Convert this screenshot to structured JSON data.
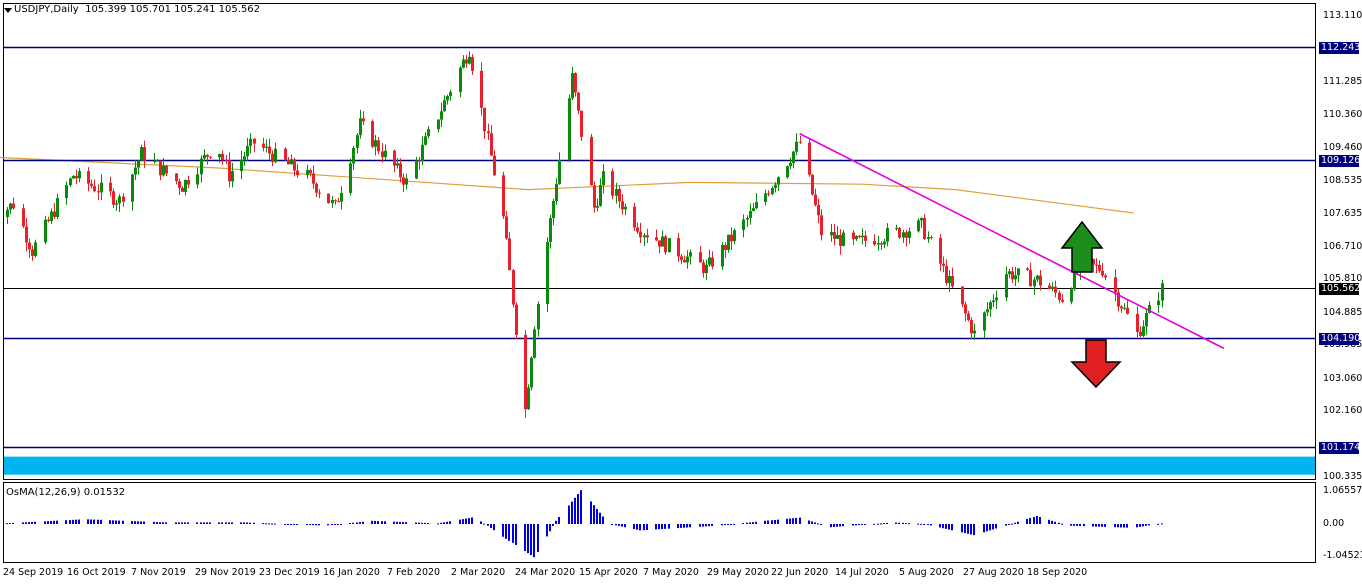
{
  "header": {
    "symbol_label": "USDJPY,Daily",
    "ohlc_text": "105.399 105.701 105.241 105.562"
  },
  "oscillator": {
    "label": "OsMA(12,26,9) 0.01532",
    "ticks": [
      "1.06557",
      "0.00",
      "-1.04521"
    ]
  },
  "colors": {
    "background": "#ffffff",
    "bull": "#0a8a0a",
    "bear": "#e8202a",
    "level_line": "#00007f",
    "trendline": "#e000e0",
    "moving_average": "#e0a040",
    "price_line": "#000000",
    "zone": "#00b4f0",
    "histogram": "#0000e0",
    "arrow_up": "#1c8c1c",
    "arrow_down": "#e02020"
  },
  "chart_data": {
    "type": "candlestick",
    "symbol": "USDJPY",
    "timeframe": "Daily",
    "last": {
      "open": 105.399,
      "high": 105.701,
      "low": 105.241,
      "close": 105.562
    },
    "y_ticks": [
      "113.110",
      "111.285",
      "110.360",
      "109.460",
      "108.535",
      "107.635",
      "106.710",
      "105.810",
      "104.885",
      "103.985",
      "103.060",
      "102.160",
      "100.335"
    ],
    "x_ticks": [
      "24 Sep 2019",
      "16 Oct 2019",
      "7 Nov 2019",
      "29 Nov 2019",
      "23 Dec 2019",
      "16 Jan 2020",
      "7 Feb 2020",
      "2 Mar 2020",
      "24 Mar 2020",
      "15 Apr 2020",
      "7 May 2020",
      "29 May 2020",
      "22 Jun 2020",
      "14 Jul 2020",
      "5 Aug 2020",
      "27 Aug 2020",
      "18 Sep 2020"
    ],
    "levels": [
      {
        "label": "112.243",
        "value": 112.243
      },
      {
        "label": "109.126",
        "value": 109.126
      },
      {
        "label": "105.562",
        "value": 105.562,
        "kind": "current"
      },
      {
        "label": "104.190",
        "value": 104.19
      },
      {
        "label": "101.174",
        "value": 101.174
      }
    ],
    "zone": {
      "from": 100.4,
      "to": 100.9
    },
    "trendline": {
      "from": {
        "date": "2020-06-05",
        "price": 109.85
      },
      "to": {
        "date": "2020-10-19",
        "price": 103.9
      }
    },
    "moving_average": [
      {
        "date": "2019-09-20",
        "price": 109.2
      },
      {
        "date": "2019-12-01",
        "price": 108.9
      },
      {
        "date": "2020-01-20",
        "price": 108.6
      },
      {
        "date": "2020-03-10",
        "price": 108.3
      },
      {
        "date": "2020-05-01",
        "price": 108.5
      },
      {
        "date": "2020-06-25",
        "price": 108.45
      },
      {
        "date": "2020-07-25",
        "price": 108.3
      },
      {
        "date": "2020-09-20",
        "price": 107.65
      }
    ],
    "price_path": [
      {
        "date": "2019-09-20",
        "price": 107.5
      },
      {
        "date": "2019-09-27",
        "price": 107.9
      },
      {
        "date": "2019-10-03",
        "price": 106.6
      },
      {
        "date": "2019-10-16",
        "price": 108.7
      },
      {
        "date": "2019-10-31",
        "price": 108.0
      },
      {
        "date": "2019-11-07",
        "price": 109.3
      },
      {
        "date": "2019-11-20",
        "price": 108.4
      },
      {
        "date": "2019-12-01",
        "price": 109.6
      },
      {
        "date": "2019-12-05",
        "price": 108.7
      },
      {
        "date": "2019-12-13",
        "price": 109.6
      },
      {
        "date": "2019-12-31",
        "price": 108.6
      },
      {
        "date": "2020-01-08",
        "price": 107.8
      },
      {
        "date": "2020-01-16",
        "price": 110.1
      },
      {
        "date": "2020-01-31",
        "price": 108.5
      },
      {
        "date": "2020-02-07",
        "price": 109.8
      },
      {
        "date": "2020-02-20",
        "price": 112.2
      },
      {
        "date": "2020-03-02",
        "price": 107.5
      },
      {
        "date": "2020-03-09",
        "price": 102.2
      },
      {
        "date": "2020-03-12",
        "price": 104.6
      },
      {
        "date": "2020-03-18",
        "price": 108.0
      },
      {
        "date": "2020-03-24",
        "price": 111.4
      },
      {
        "date": "2020-03-31",
        "price": 107.8
      },
      {
        "date": "2020-04-03",
        "price": 108.6
      },
      {
        "date": "2020-04-15",
        "price": 107.2
      },
      {
        "date": "2020-05-06",
        "price": 106.1
      },
      {
        "date": "2020-05-21",
        "price": 107.7
      },
      {
        "date": "2020-06-05",
        "price": 109.6
      },
      {
        "date": "2020-06-12",
        "price": 107.1
      },
      {
        "date": "2020-06-22",
        "price": 106.8
      },
      {
        "date": "2020-07-14",
        "price": 107.3
      },
      {
        "date": "2020-07-31",
        "price": 104.3
      },
      {
        "date": "2020-08-10",
        "price": 106.0
      },
      {
        "date": "2020-08-20",
        "price": 105.8
      },
      {
        "date": "2020-08-28",
        "price": 105.3
      },
      {
        "date": "2020-09-03",
        "price": 106.2
      },
      {
        "date": "2020-09-10",
        "price": 106.1
      },
      {
        "date": "2020-09-21",
        "price": 104.3
      },
      {
        "date": "2020-09-29",
        "price": 105.56
      }
    ],
    "osma_shape": [
      {
        "date": "2019-09-20",
        "value": 0.0
      },
      {
        "date": "2019-10-20",
        "value": 0.15
      },
      {
        "date": "2019-11-15",
        "value": 0.05
      },
      {
        "date": "2019-12-10",
        "value": 0.05
      },
      {
        "date": "2020-01-05",
        "value": -0.05
      },
      {
        "date": "2020-01-20",
        "value": 0.1
      },
      {
        "date": "2020-02-10",
        "value": 0.02
      },
      {
        "date": "2020-02-22",
        "value": 0.22
      },
      {
        "date": "2020-03-02",
        "value": -0.4
      },
      {
        "date": "2020-03-12",
        "value": -1.04
      },
      {
        "date": "2020-03-19",
        "value": 0.1
      },
      {
        "date": "2020-03-27",
        "value": 1.06
      },
      {
        "date": "2020-04-05",
        "value": 0.0
      },
      {
        "date": "2020-04-15",
        "value": -0.2
      },
      {
        "date": "2020-05-10",
        "value": -0.05
      },
      {
        "date": "2020-05-25",
        "value": 0.1
      },
      {
        "date": "2020-06-05",
        "value": 0.2
      },
      {
        "date": "2020-06-15",
        "value": -0.1
      },
      {
        "date": "2020-07-05",
        "value": 0.05
      },
      {
        "date": "2020-07-15",
        "value": 0.0
      },
      {
        "date": "2020-07-31",
        "value": -0.35
      },
      {
        "date": "2020-08-20",
        "value": 0.25
      },
      {
        "date": "2020-08-30",
        "value": -0.05
      },
      {
        "date": "2020-09-20",
        "value": -0.12
      },
      {
        "date": "2020-09-29",
        "value": 0.02
      }
    ],
    "annotations": [
      {
        "type": "arrow",
        "direction": "up",
        "color": "#1c8c1c"
      },
      {
        "type": "arrow",
        "direction": "down",
        "color": "#e02020"
      }
    ]
  }
}
